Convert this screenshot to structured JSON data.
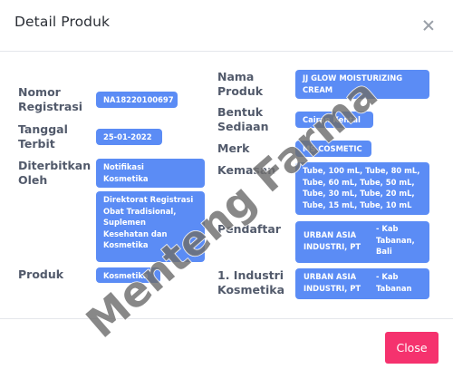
{
  "modal": {
    "title": "Detail Produk",
    "close_icon": "close-icon"
  },
  "left": {
    "nomor_registrasi": {
      "label": "Nomor\nRegistrasi",
      "value": "NA18220100697"
    },
    "tanggal_terbit": {
      "label": "Tanggal\nTerbit",
      "value": "25-01-2022"
    },
    "diterbitkan_oleh": {
      "label": "Diterbitkan\nOleh",
      "value1": "Notifikasi\nKosmetika",
      "value2": "Direktorat Registrasi\nObat Tradisional,\nSuplemen\nKesehatan dan\nKosmetika"
    },
    "produk": {
      "label": "Produk",
      "value": "Kosmetika"
    }
  },
  "right": {
    "nama_produk": {
      "label": "Nama\nProduk",
      "value": "JJ GLOW MOISTURIZING\nCREAM"
    },
    "bentuk_sediaan": {
      "label": "Bentuk\nSediaan",
      "value": "Cairan Kental"
    },
    "merk": {
      "label": "Merk",
      "value": "MS COSMETIC"
    },
    "kemasan": {
      "label": "Kemasan",
      "value": "Tube, 100 mL, Tube, 80 mL,\nTube, 60 mL, Tube, 50 mL,\nTube, 30 mL, Tube, 20 mL,\nTube, 15 mL, Tube, 10 mL"
    },
    "pendaftar": {
      "label": "Pendaftar",
      "name": "URBAN ASIA\nINDUSTRI, PT",
      "location": "- Kab\nTabanan,\nBali"
    },
    "industri": {
      "label": "1. Industri\nKosmetika",
      "name": "URBAN ASIA\nINDUSTRI, PT",
      "location": "- Kab\nTabanan"
    }
  },
  "footer": {
    "close_label": "Close"
  },
  "watermark": {
    "text": "Menteng Farma"
  },
  "colors": {
    "chip": "#5b8cf5",
    "close_button": "#f5326e",
    "label": "#525a6b"
  }
}
